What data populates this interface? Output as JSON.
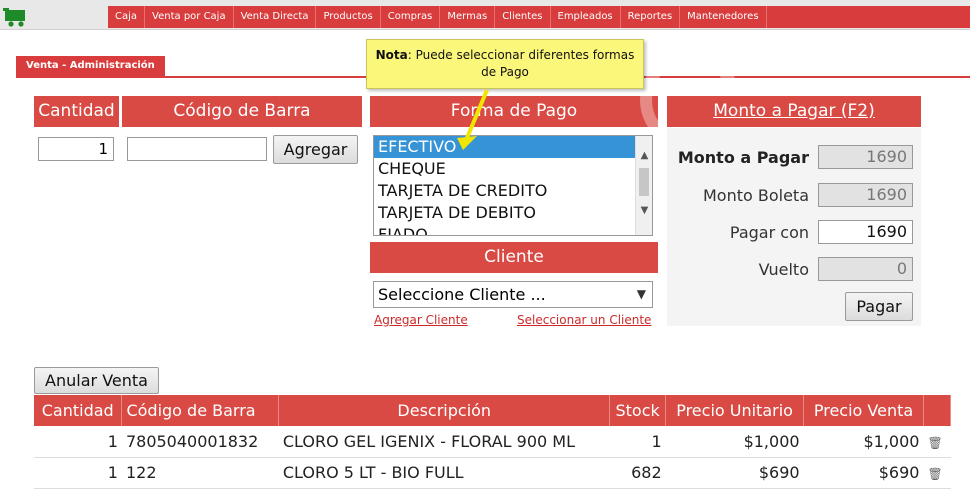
{
  "menu": [
    "Caja",
    "Venta por Caja",
    "Venta Directa",
    "Productos",
    "Compras",
    "Mermas",
    "Clientes",
    "Empleados",
    "Reportes",
    "Mantenedores"
  ],
  "section_title": "Venta - Administración",
  "note": {
    "bold": "Nota",
    "text": ": Puede seleccionar diferentes formas de Pago"
  },
  "headers": {
    "cantidad": "Cantidad",
    "codigo": "Código de Barra",
    "forma_pago": "Forma de Pago",
    "cliente": "Cliente",
    "monto": "Monto a Pagar (F2)"
  },
  "inputs": {
    "cantidad": "1",
    "codigo": ""
  },
  "buttons": {
    "agregar": "Agregar",
    "pagar": "Pagar",
    "anular": "Anular Venta"
  },
  "payment_options": [
    "EFECTIVO",
    "CHEQUE",
    "TARJETA DE CREDITO",
    "TARJETA DE DEBITO",
    "FIADO"
  ],
  "selected_payment": "EFECTIVO",
  "cliente_select": "Seleccione Cliente ...",
  "links": {
    "agregar_cliente": "Agregar Cliente",
    "seleccionar_cliente": "Seleccionar un Cliente"
  },
  "payment": {
    "monto_label": "Monto a Pagar",
    "monto": "1690",
    "boleta_label": "Monto Boleta",
    "boleta": "1690",
    "pagar_con_label": "Pagar con",
    "pagar_con": "1690",
    "vuelto_label": "Vuelto",
    "vuelto": "0"
  },
  "table": {
    "columns": [
      "Cantidad",
      "Código de Barra",
      "Descripción",
      "Stock",
      "Precio Unitario",
      "Precio Venta"
    ],
    "rows": [
      {
        "cantidad": "1",
        "codigo": "7805040001832",
        "descripcion": "CLORO GEL IGENIX - FLORAL 900 ML",
        "stock": "1",
        "unitario": "$1,000",
        "venta": "$1,000"
      },
      {
        "cantidad": "1",
        "codigo": "122",
        "descripcion": "CLORO 5 LT - BIO FULL",
        "stock": "682",
        "unitario": "$690",
        "venta": "$690"
      }
    ]
  },
  "colors": {
    "brand_red": "#d94a44",
    "menu_red": "#d93c3c",
    "selection_blue": "#3593d6",
    "note_yellow": "#fbf77b"
  }
}
